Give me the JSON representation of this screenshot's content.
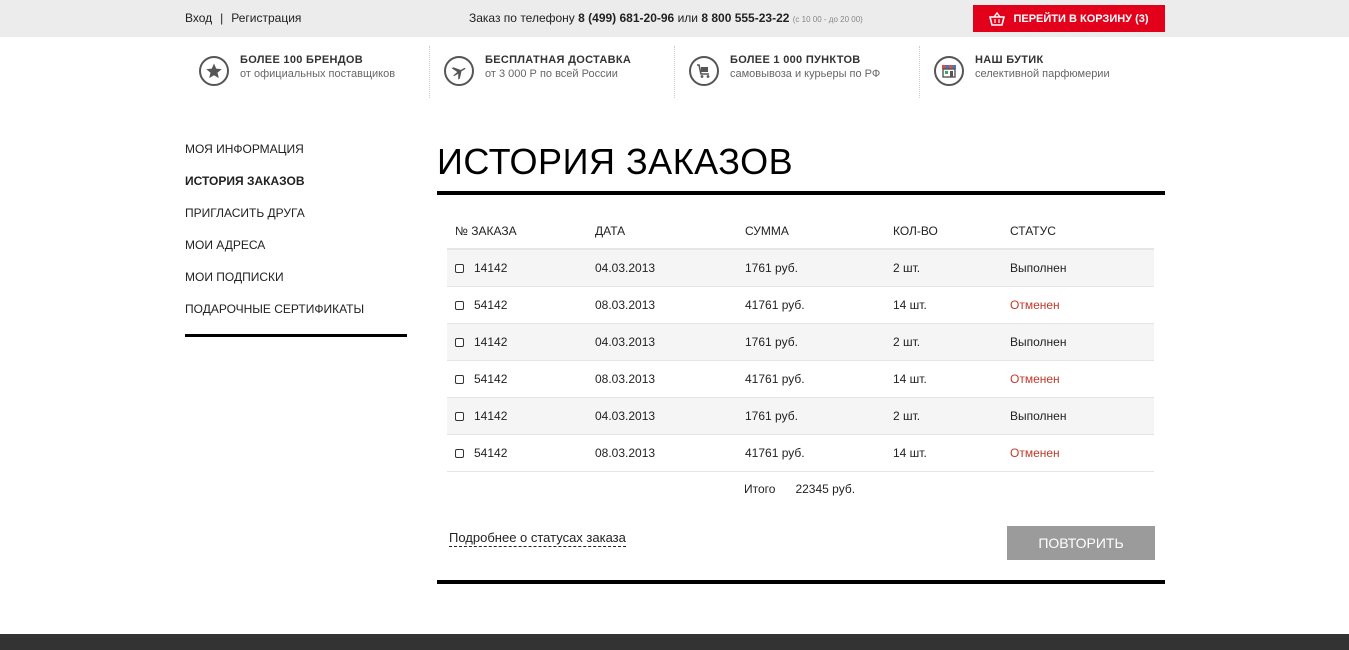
{
  "topbar": {
    "login": "Вход",
    "separator": "|",
    "register": "Регистрация",
    "phone_prefix": "Заказ по телефону",
    "phone1": "8 (499) 681-20-96",
    "phone_or": "или",
    "phone2": "8 800 555-23-22",
    "hours": "(с 10 00 - до 20 00)",
    "cart_label": "ПЕРЕЙТИ В КОРЗИНУ (3)",
    "cart_icon": "basket-icon"
  },
  "features": [
    {
      "icon": "star-icon",
      "title": "БОЛЕЕ 100 БРЕНДОВ",
      "subtitle": "от официальных поставщиков"
    },
    {
      "icon": "airplane-icon",
      "title": "БЕСПЛАТНАЯ ДОСТАВКА",
      "subtitle": "от 3 000 Р по всей России"
    },
    {
      "icon": "cart-icon",
      "title": "БОЛЕЕ 1 000 ПУНКТОВ",
      "subtitle": "самовывоза и курьеры по РФ"
    },
    {
      "icon": "shop-icon",
      "title": "НАШ БУТИК",
      "subtitle": "селективной парфюмерии"
    }
  ],
  "sidebar": {
    "items": [
      {
        "label": "МОЯ ИНФОРМАЦИЯ"
      },
      {
        "label": "ИСТОРИЯ ЗАКАЗОВ"
      },
      {
        "label": "ПРИГЛАСИТЬ ДРУГА"
      },
      {
        "label": "МОИ АДРЕСА"
      },
      {
        "label": "МОИ ПОДПИСКИ"
      },
      {
        "label": "ПОДАРОЧНЫЕ СЕРТИФИКАТЫ"
      }
    ]
  },
  "main": {
    "title": "ИСТОРИЯ ЗАКАЗОВ",
    "columns": [
      "№ ЗАКАЗА",
      "ДАТА",
      "СУММА",
      "КОЛ-ВО",
      "СТАТУС"
    ],
    "rows": [
      {
        "number": "14142",
        "date": "04.03.2013",
        "sum": "1761 руб.",
        "qty": "2 шт.",
        "status": "Выполнен"
      },
      {
        "number": "54142",
        "date": "08.03.2013",
        "sum": "41761 руб.",
        "qty": "14 шт.",
        "status": "Отменен"
      },
      {
        "number": "14142",
        "date": "04.03.2013",
        "sum": "1761 руб.",
        "qty": "2 шт.",
        "status": "Выполнен"
      },
      {
        "number": "54142",
        "date": "08.03.2013",
        "sum": "41761 руб.",
        "qty": "14 шт.",
        "status": "Отменен"
      },
      {
        "number": "14142",
        "date": "04.03.2013",
        "sum": "1761 руб.",
        "qty": "2 шт.",
        "status": "Выполнен"
      },
      {
        "number": "54142",
        "date": "08.03.2013",
        "sum": "41761 руб.",
        "qty": "14 шт.",
        "status": "Отменен"
      }
    ],
    "total_label": "Итого",
    "total_value": "22345 руб.",
    "more_link": "Подробнее о статусах заказа",
    "repeat_button": "ПОВТОРИТЬ"
  },
  "colors": {
    "accent": "#e2001a",
    "cancel_status": "#c0392b",
    "button_gray": "#9b9b9b"
  }
}
